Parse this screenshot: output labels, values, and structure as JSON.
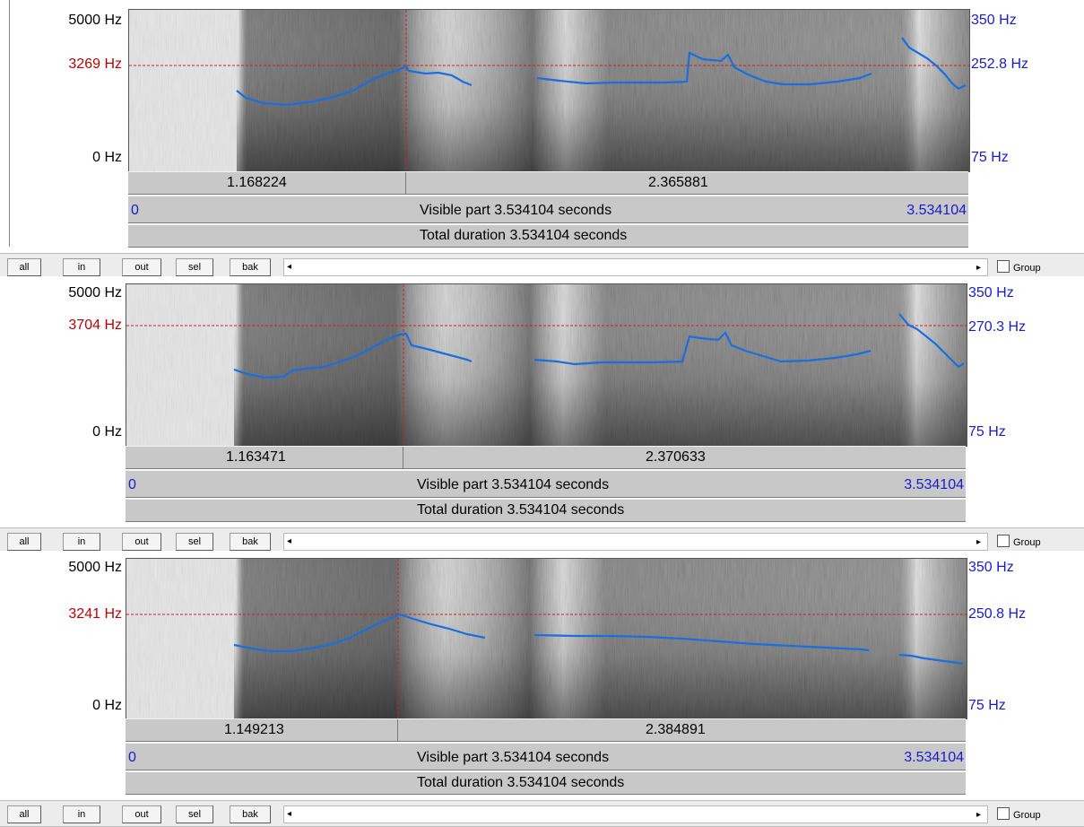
{
  "panes": [
    {
      "freq_top": "5000 Hz",
      "freq_cursor": "3269 Hz",
      "freq_bottom": "0 Hz",
      "pitch_top": "350 Hz",
      "pitch_cursor": "252.8 Hz",
      "pitch_bottom": "75 Hz",
      "segment_left": "1.168224",
      "segment_right": "2.365881",
      "visible_start": "0",
      "visible_label": "Visible part 3.534104 seconds",
      "visible_end": "3.534104",
      "total_label": "Total duration 3.534104 seconds"
    },
    {
      "freq_top": "5000 Hz",
      "freq_cursor": "3704 Hz",
      "freq_bottom": "0 Hz",
      "pitch_top": "350 Hz",
      "pitch_cursor": "270.3 Hz",
      "pitch_bottom": "75 Hz",
      "segment_left": "1.163471",
      "segment_right": "2.370633",
      "visible_start": "0",
      "visible_label": "Visible part 3.534104 seconds",
      "visible_end": "3.534104",
      "total_label": "Total duration 3.534104 seconds"
    },
    {
      "freq_top": "5000 Hz",
      "freq_cursor": "3241 Hz",
      "freq_bottom": "0 Hz",
      "pitch_top": "350 Hz",
      "pitch_cursor": "250.8 Hz",
      "pitch_bottom": "75 Hz",
      "segment_left": "1.149213",
      "segment_right": "2.384891",
      "visible_start": "0",
      "visible_label": "Visible part 3.534104 seconds",
      "visible_end": "3.534104",
      "total_label": "Total duration 3.534104 seconds"
    }
  ],
  "toolbar": {
    "all": "all",
    "in": "in",
    "out": "out",
    "sel": "sel",
    "bak": "bak",
    "group": "Group",
    "arrow_left": "◂",
    "arrow_right": "▸"
  },
  "colors": {
    "cursor_line": "#d02020",
    "pitch_line": "#1a6fe0",
    "freq_cursor_label": "#c00000",
    "pitch_label": "#1a1ad0"
  }
}
